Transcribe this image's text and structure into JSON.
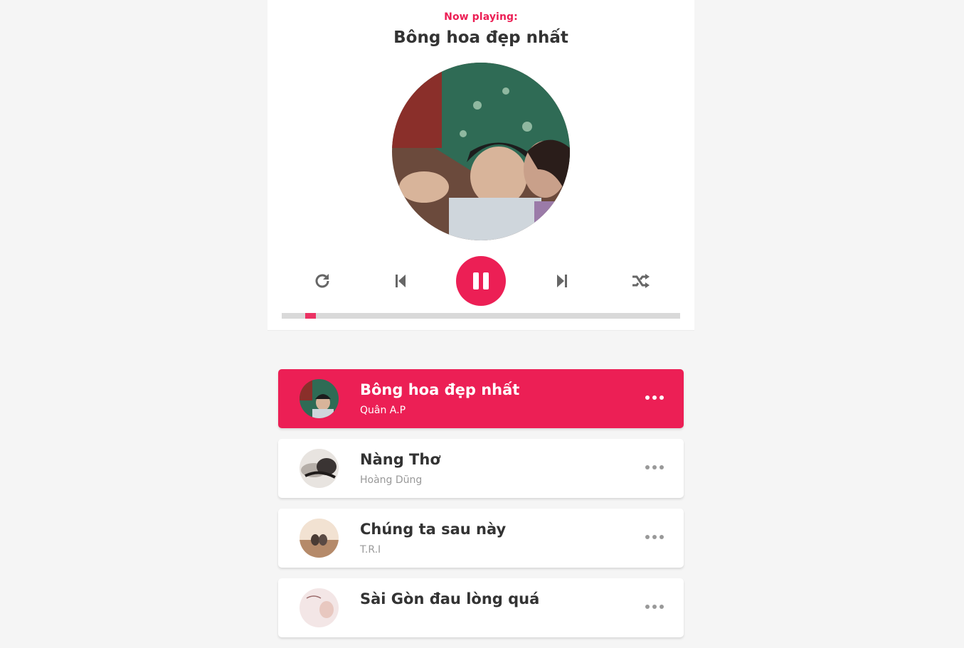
{
  "header": {
    "now_playing_label": "Now playing:",
    "current_title": "Bông hoa đẹp nhất"
  },
  "controls": {
    "repeat_icon": "repeat-icon",
    "prev_icon": "step-backward-icon",
    "play_state": "playing",
    "pause_icon": "pause-icon",
    "next_icon": "step-forward-icon",
    "shuffle_icon": "shuffle-icon"
  },
  "progress": {
    "percent": 6
  },
  "colors": {
    "accent": "#ec1f55",
    "text": "#333333",
    "muted": "#999999"
  },
  "playlist": [
    {
      "title": "Bông hoa đẹp nhất",
      "artist": "Quân A.P",
      "active": true
    },
    {
      "title": "Nàng Thơ",
      "artist": "Hoàng Dũng",
      "active": false
    },
    {
      "title": "Chúng ta sau này",
      "artist": "T.R.I",
      "active": false
    },
    {
      "title": "Sài Gòn đau lòng quá",
      "artist": "",
      "active": false
    }
  ]
}
